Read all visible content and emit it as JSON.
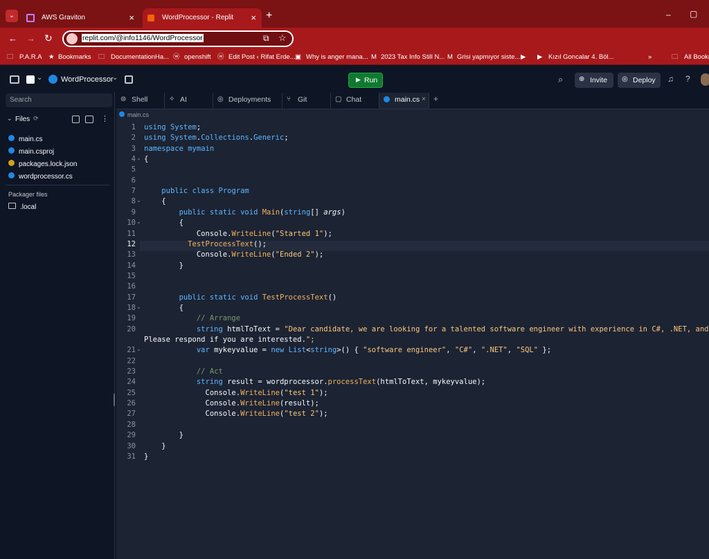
{
  "browser": {
    "tabs": [
      {
        "title": "AWS Graviton",
        "close": "×"
      },
      {
        "title": "WordProcessor - Replit",
        "close": "×"
      }
    ],
    "new_tab": "+",
    "window_controls": {
      "minimize": "–",
      "maximize": "▢"
    },
    "url": "replit.com/@info1146/WordProcessor",
    "bookmarks": [
      "P.A.R.A",
      "Bookmarks",
      "DocumentationHa...",
      "openshift",
      "Edit Post ‹ Rifat Erde...",
      "Why is anger mana...",
      "2023 Tax Info Still N...",
      "Grisi yapmıyor siste...",
      "Kızıl Goncalar 4. Böl...",
      "All Bookm"
    ],
    "more_bookmarks": "»"
  },
  "replit": {
    "project_name": "WordProcessor",
    "run_label": "Run",
    "invite_label": "Invite",
    "deploy_label": "Deploy",
    "tool_tabs": [
      "Shell",
      "AI",
      "Deployments",
      "Git",
      "Chat",
      "main.cs"
    ],
    "breadcrumb": "main.cs"
  },
  "sidebar": {
    "search_placeholder": "Search",
    "files_label": "Files",
    "files": [
      "main.cs",
      "main.csproj",
      "packages.lock.json",
      "wordprocessor.cs"
    ],
    "packager_label": "Packager files",
    "packager_folder": ".local"
  },
  "editor": {
    "active_line": 12,
    "lines": [
      "using System;",
      "using System.Collections.Generic;",
      "namespace mymain",
      "{",
      "",
      "",
      "    public class Program",
      "    {",
      "        public static void Main(string[] args)",
      "        {",
      "            Console.WriteLine(\"Started 1\");",
      "          TestProcessText();",
      "            Console.WriteLine(\"Ended 2\");",
      "        }",
      "",
      "",
      "        public static void TestProcessText()",
      "        {",
      "            // Arrange",
      "            string htmlToText = \"Dear candidate, we are looking for a talented software engineer with experience in C#, .NET, and SQL.",
      "Please respond if you are interested.\";",
      "            var mykeyvalue = new List<string>() { \"software engineer\", \"C#\", \".NET\", \"SQL\" };",
      "",
      "            // Act",
      "            string result = wordprocessor.processText(htmlToText, mykeyvalue);",
      "              Console.WriteLine(\"test 1\");",
      "              Console.WriteLine(result);",
      "              Console.WriteLine(\"test 2\");",
      "",
      "        }",
      "    }",
      "}"
    ],
    "line_numbers": [
      "1",
      "2",
      "3",
      "4",
      "5",
      "6",
      "7",
      "8",
      "9",
      "10",
      "11",
      "12",
      "13",
      "14",
      "15",
      "16",
      "17",
      "18",
      "19",
      "20",
      "",
      "21",
      "22",
      "23",
      "24",
      "25",
      "26",
      "27",
      "28",
      "29",
      "30",
      "31"
    ]
  },
  "colors": {
    "browser_frame": "#a8191c",
    "accent_run": "#0f7a2f",
    "editor_bg": "#1c2333",
    "ide_bg": "#0e1525"
  }
}
